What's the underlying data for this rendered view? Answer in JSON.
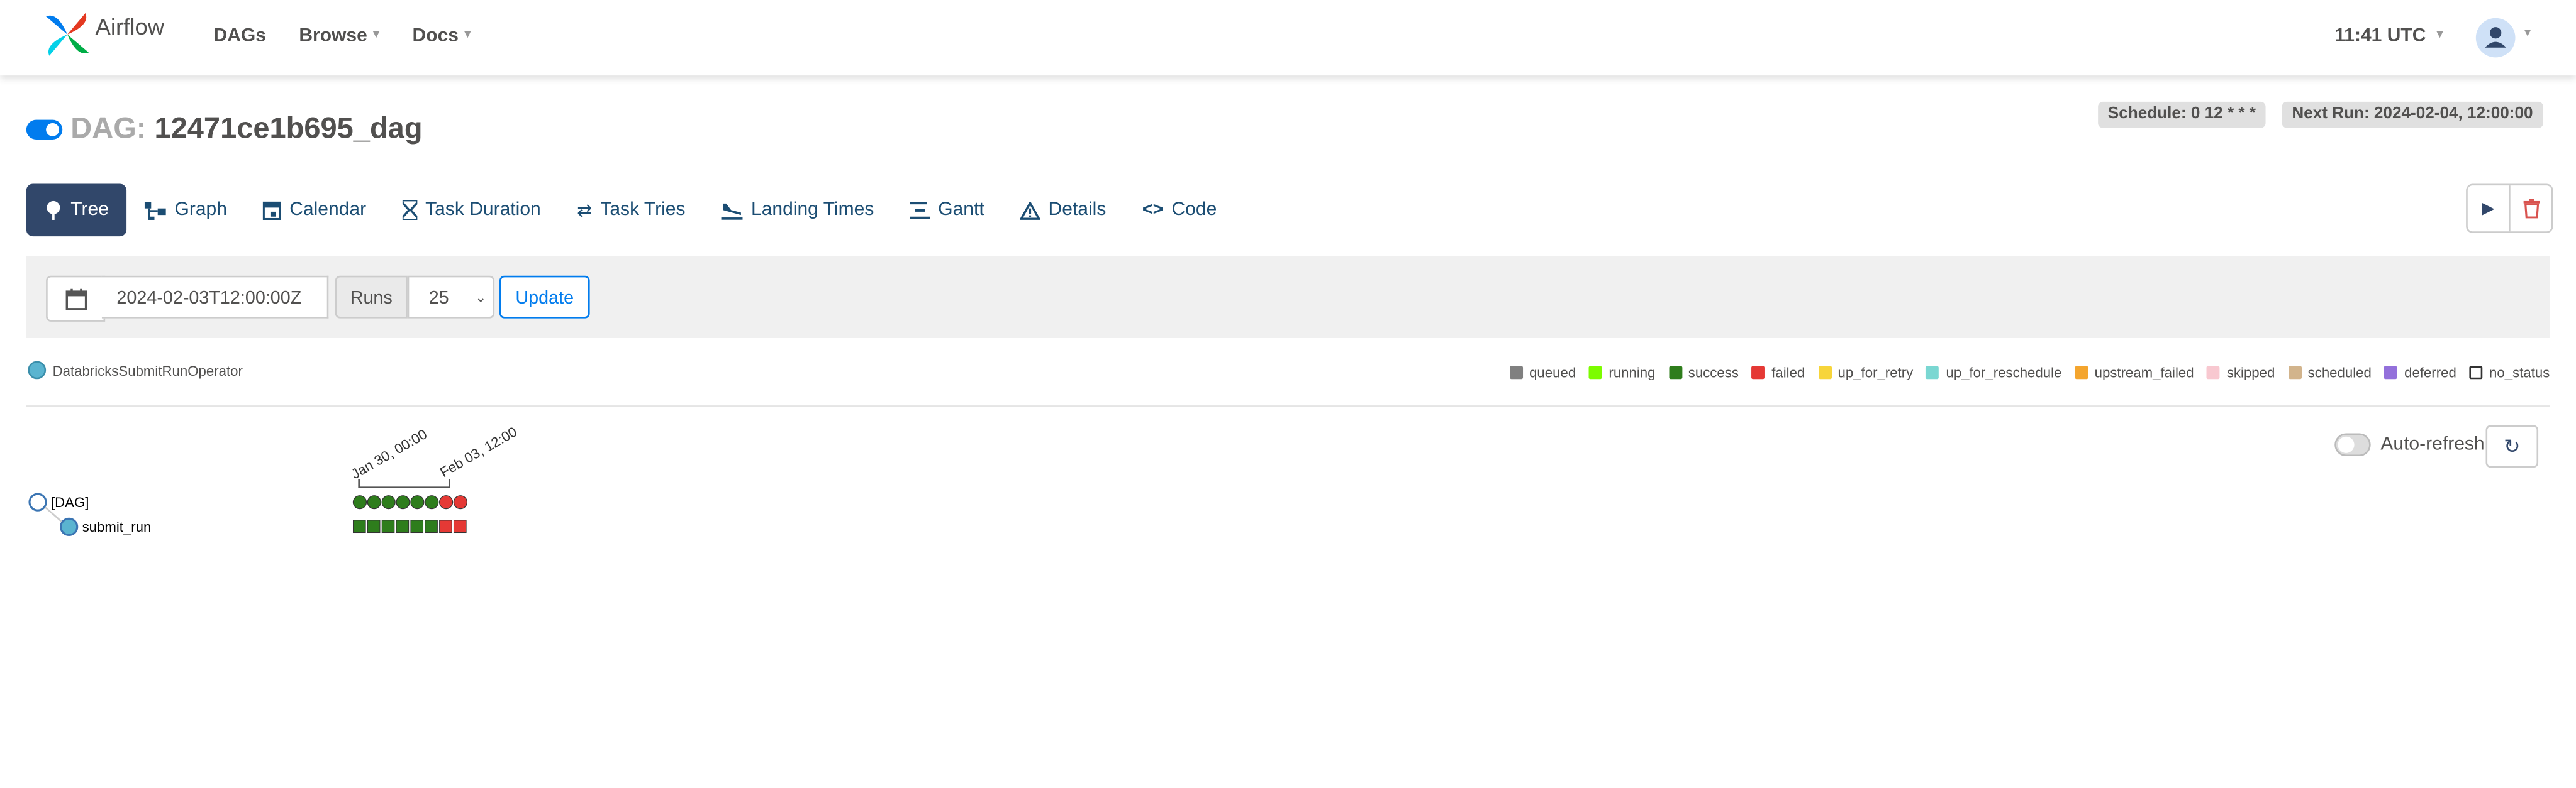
{
  "navbar": {
    "brand": "Airflow",
    "items": [
      {
        "label": "DAGs",
        "dropdown": false
      },
      {
        "label": "Browse",
        "dropdown": true
      },
      {
        "label": "Docs",
        "dropdown": true
      }
    ],
    "time": "11:41 UTC",
    "avatar_icon": "user-icon"
  },
  "dag": {
    "prefix": "DAG:",
    "id": "12471ce1b695_dag",
    "paused": false,
    "schedule": "Schedule: 0 12 * * *",
    "next_run": "Next Run: 2024-02-04, 12:00:00"
  },
  "tabs": [
    {
      "label": "Tree",
      "icon": "tree-icon",
      "active": true
    },
    {
      "label": "Graph",
      "icon": "graph-icon",
      "active": false
    },
    {
      "label": "Calendar",
      "icon": "calendar-icon",
      "active": false
    },
    {
      "label": "Task Duration",
      "icon": "hourglass-icon",
      "active": false
    },
    {
      "label": "Task Tries",
      "icon": "retry-icon",
      "active": false
    },
    {
      "label": "Landing Times",
      "icon": "plane-landing-icon",
      "active": false
    },
    {
      "label": "Gantt",
      "icon": "gantt-icon",
      "active": false
    },
    {
      "label": "Details",
      "icon": "warning-triangle-icon",
      "active": false
    },
    {
      "label": "Code",
      "icon": "code-icon",
      "active": false
    }
  ],
  "filter": {
    "base_date": "2024-02-03T12:00:00Z",
    "runs_label": "Runs",
    "runs_value": "25",
    "update_label": "Update"
  },
  "operator": "DatabricksSubmitRunOperator",
  "legend": [
    {
      "label": "queued",
      "color": "#808080"
    },
    {
      "label": "running",
      "color": "#7cfc00"
    },
    {
      "label": "success",
      "color": "#2e7d1c"
    },
    {
      "label": "failed",
      "color": "#e53935"
    },
    {
      "label": "up_for_retry",
      "color": "#f7d53a"
    },
    {
      "label": "up_for_reschedule",
      "color": "#7ad7d2"
    },
    {
      "label": "upstream_failed",
      "color": "#f4a52e"
    },
    {
      "label": "skipped",
      "color": "#f8c8d0"
    },
    {
      "label": "scheduled",
      "color": "#d2b48c"
    },
    {
      "label": "deferred",
      "color": "#9370db"
    },
    {
      "label": "no_status",
      "color": "#ffffff"
    }
  ],
  "autorefresh": {
    "label": "Auto-refresh",
    "enabled": false
  },
  "tree": {
    "date_labels": [
      "Jan 30, 00:00",
      "Feb 03, 12:00"
    ],
    "nodes": [
      {
        "label": "[DAG]"
      },
      {
        "label": "submit_run"
      }
    ],
    "dag_runs": [
      "success",
      "success",
      "success",
      "success",
      "success",
      "success",
      "failed",
      "failed"
    ],
    "task_instances": [
      "success",
      "success",
      "success",
      "success",
      "success",
      "success",
      "failed",
      "failed"
    ]
  }
}
